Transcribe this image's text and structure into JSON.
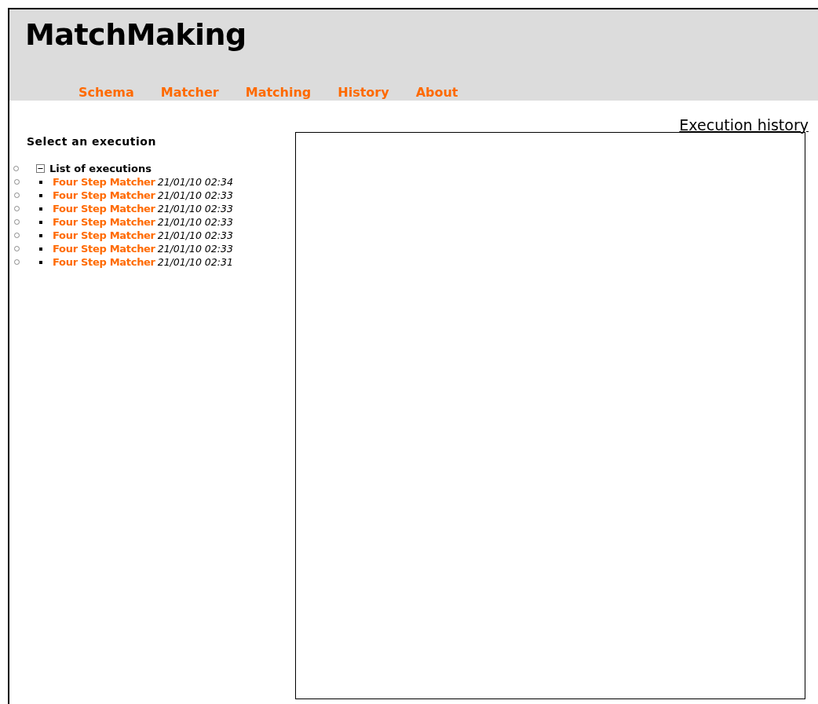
{
  "app": {
    "title": "MatchMaking"
  },
  "nav": [
    {
      "label": "Schema"
    },
    {
      "label": "Matcher"
    },
    {
      "label": "Matching"
    },
    {
      "label": "History"
    },
    {
      "label": "About"
    }
  ],
  "page_title": "Execution history",
  "sidebar": {
    "heading": "Select an execution",
    "tree": {
      "label": "List of executions",
      "expanded": true,
      "children": [
        {
          "name": "Four Step Matcher",
          "time": "21/01/10 02:34"
        },
        {
          "name": "Four Step Matcher",
          "time": "21/01/10 02:33"
        },
        {
          "name": "Four Step Matcher",
          "time": "21/01/10 02:33"
        },
        {
          "name": "Four Step Matcher",
          "time": "21/01/10 02:33"
        },
        {
          "name": "Four Step Matcher",
          "time": "21/01/10 02:33"
        },
        {
          "name": "Four Step Matcher",
          "time": "21/01/10 02:33"
        },
        {
          "name": "Four Step Matcher",
          "time": "21/01/10 02:31"
        }
      ]
    }
  }
}
